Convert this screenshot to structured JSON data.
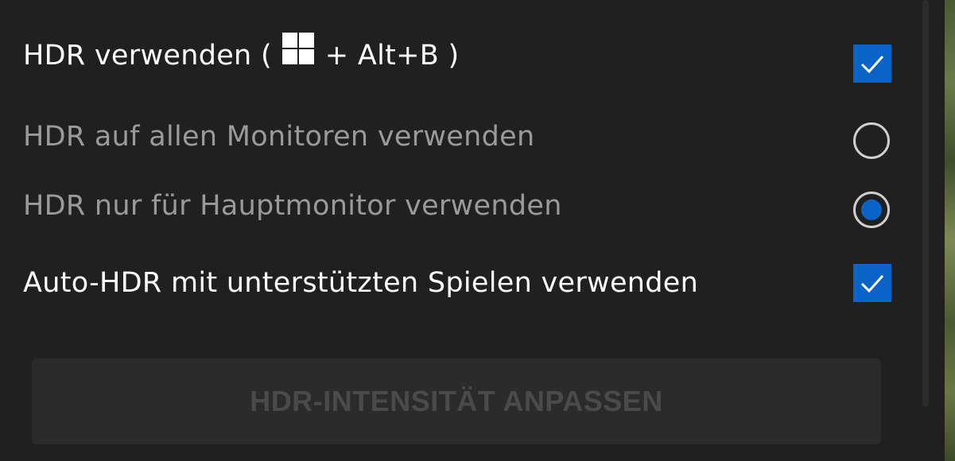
{
  "hdr": {
    "label_prefix": "HDR verwenden (",
    "label_suffix": "+ Alt+B )",
    "checked": true
  },
  "all_monitors": {
    "label": "HDR auf allen Monitoren verwenden",
    "selected": false
  },
  "main_monitor": {
    "label": "HDR nur für Hauptmonitor verwenden",
    "selected": true
  },
  "auto_hdr": {
    "label": "Auto-HDR mit unterstützten Spielen verwenden",
    "checked": true
  },
  "intensity": {
    "label": "HDR-INTENSITÄT ANPASSEN"
  },
  "colors": {
    "accent": "#0a64c8",
    "background": "#202020",
    "text_active": "#ffffff",
    "text_disabled": "#9a9a9a"
  },
  "icons": {
    "hotkey_icon": "windows-logo-icon",
    "check_icon": "checkmark-icon"
  }
}
